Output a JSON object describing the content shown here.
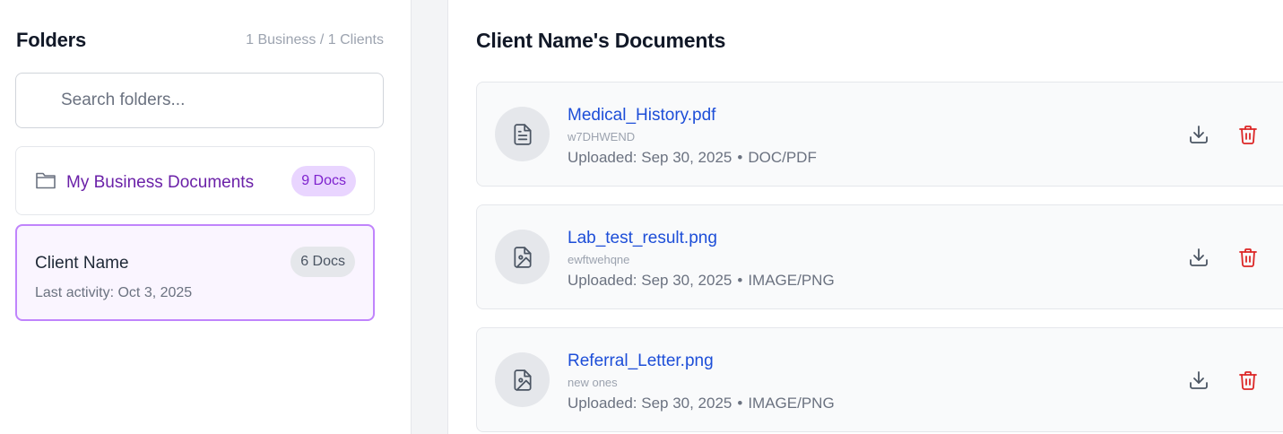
{
  "sidebar": {
    "title": "Folders",
    "count": "1 Business / 1 Clients",
    "search": {
      "placeholder": "Search folders...",
      "value": ""
    },
    "folders": [
      {
        "name": "My Business Documents",
        "badge": "9 Docs"
      },
      {
        "name": "Client Name",
        "badge": "6 Docs",
        "meta": "Last activity: Oct 3, 2025"
      }
    ]
  },
  "main": {
    "title": "Client Name's Documents",
    "documents": [
      {
        "name": "Medical_History.pdf",
        "description": "w7DHWEND",
        "uploaded": "Uploaded: Sep 30, 2025",
        "type": "DOC/PDF",
        "icon": "file-text-icon"
      },
      {
        "name": "Lab_test_result.png",
        "description": "ewftwehqne",
        "uploaded": "Uploaded: Sep 30, 2025",
        "type": "IMAGE/PNG",
        "icon": "file-image-icon"
      },
      {
        "name": "Referral_Letter.png",
        "description": "new ones",
        "uploaded": "Uploaded: Sep 30, 2025",
        "type": "IMAGE/PNG",
        "icon": "file-image-icon"
      }
    ],
    "separator": "•"
  },
  "colors": {
    "accent_purple": "#7e22ce",
    "link_blue": "#1d4ed8",
    "delete_red": "#dc2626"
  }
}
